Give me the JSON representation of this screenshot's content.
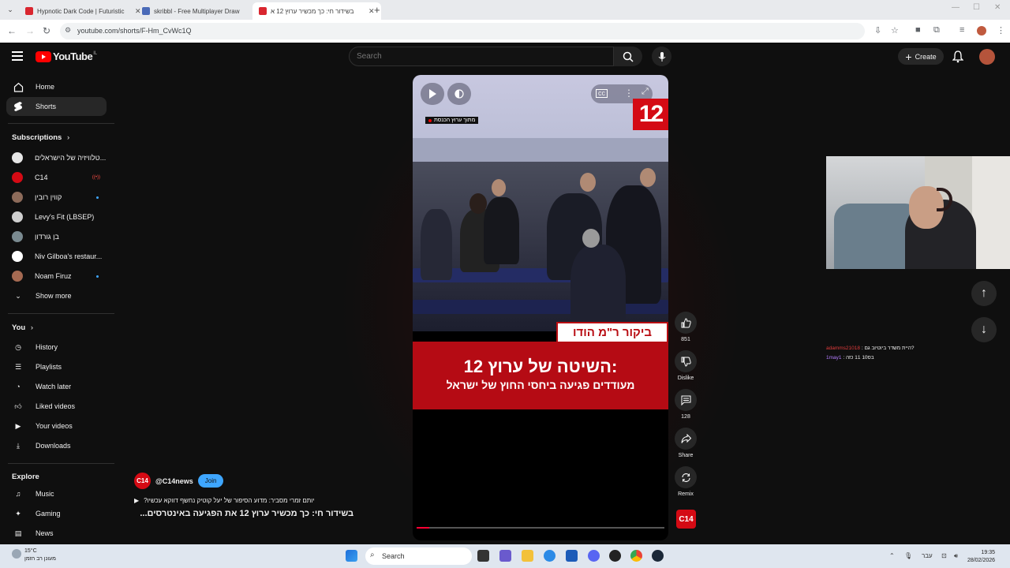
{
  "browser": {
    "tabs": [
      {
        "title": "Hypnotic Dark Code | Futuristic",
        "favicon_color": "#d9262f"
      },
      {
        "title": "skribbl - Free Multiplayer Draw",
        "favicon_color": "#4a6ab8"
      },
      {
        "title": "בשידור חי: כך מכשיר ערוץ 12 א",
        "favicon_color": "#d9262f"
      }
    ],
    "url": "youtube.com/shorts/F-Hm_CvWc1Q"
  },
  "header": {
    "logo_text": "YouTube",
    "country_code": "IL",
    "search_placeholder": "Search",
    "create_label": "Create"
  },
  "sidebar": {
    "main": [
      {
        "label": "Home",
        "icon": "home-icon"
      },
      {
        "label": "Shorts",
        "icon": "shorts-icon",
        "active": true
      }
    ],
    "subscriptions_header": "Subscriptions",
    "subscriptions": [
      {
        "label": "טלוויזיה של הישראלים...",
        "avatar_color": "#e6e6e6"
      },
      {
        "label": "C14",
        "avatar_color": "#d40a14",
        "live": true
      },
      {
        "label": "קווין רובין",
        "avatar_color": "#8d6b5a",
        "dot": true
      },
      {
        "label": "Levy's Fit (LBSEP)",
        "avatar_color": "#cfcfcf"
      },
      {
        "label": "בן גורדון",
        "avatar_color": "#7a8a90"
      },
      {
        "label": "Niv Gilboa's restaur...",
        "avatar_color": "#ffffff"
      },
      {
        "label": "Noam Firuz",
        "avatar_color": "#a56a52",
        "dot": true
      }
    ],
    "show_more": "Show more",
    "you_header": "You",
    "you": [
      {
        "label": "History",
        "icon": "history-icon"
      },
      {
        "label": "Playlists",
        "icon": "playlists-icon"
      },
      {
        "label": "Watch later",
        "icon": "watch-later-icon"
      },
      {
        "label": "Liked videos",
        "icon": "like-icon"
      },
      {
        "label": "Your videos",
        "icon": "your-videos-icon"
      },
      {
        "label": "Downloads",
        "icon": "download-icon"
      }
    ],
    "explore_header": "Explore",
    "explore": [
      {
        "label": "Music",
        "icon": "music-icon"
      },
      {
        "label": "Gaming",
        "icon": "gaming-icon"
      },
      {
        "label": "News",
        "icon": "news-icon"
      }
    ]
  },
  "video": {
    "source_badge": "מתוך ערוץ הכנסת",
    "channel_logo": "12",
    "lower_third": "ביקור ר\"מ הודו",
    "headline": "השיטה של ערוץ 12:",
    "subheadline": "מעודדים פגיעה ביחסי החוץ של ישראל",
    "progress": 0.05
  },
  "actions": {
    "likes": "851",
    "dislike_label": "Dislike",
    "comments": "128",
    "share_label": "Share",
    "remix_label": "Remix",
    "channel_badge": "C14"
  },
  "meta": {
    "channel_logo": "C14",
    "channel_handle": "@C14news",
    "join_label": "Join",
    "audio_line": "יותם זמרי מסביר: מדוע הסיפור של יעל קוטיק נחשף דווקא עכשיו?",
    "title": "בשידור חי: כך מכשיר ערוץ 12 את הפגיעה באינטרסים..."
  },
  "chat": [
    {
      "user": "adamms21018",
      "text": ": היית משדר ביוטיוב גם?"
    },
    {
      "user": "1may1",
      "text": ": בס10 11 כזה"
    }
  ],
  "taskbar": {
    "temp": "15°C",
    "weather": "מעונן רב הזמן",
    "search_label": "Search",
    "lang": "עבר",
    "time": "19:35",
    "date": "28/02/2026"
  }
}
